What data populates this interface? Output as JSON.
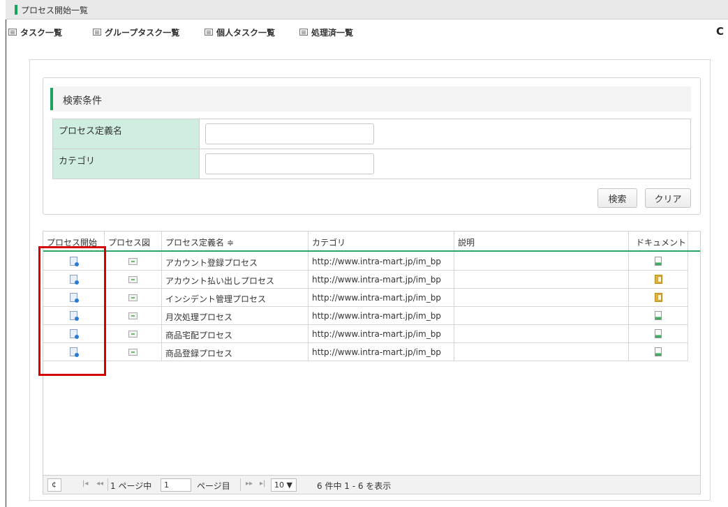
{
  "window": {
    "title": "プロセス開始一覧"
  },
  "tabs": [
    {
      "label": "タスク一覧"
    },
    {
      "label": "グループタスク一覧"
    },
    {
      "label": "個人タスク一覧"
    },
    {
      "label": "処理済一覧"
    }
  ],
  "search": {
    "heading": "検索条件",
    "fields": [
      {
        "label": "プロセス定義名",
        "value": "",
        "placeholder": ""
      },
      {
        "label": "カテゴリ",
        "value": "",
        "placeholder": ""
      }
    ],
    "search_button": "検索",
    "clear_button": "クリア"
  },
  "grid": {
    "columns": [
      "プロセス開始",
      "プロセス図",
      "プロセス定義名 ≑",
      "カテゴリ",
      "説明",
      "ドキュメント"
    ],
    "rows": [
      {
        "name": "アカウント登録プロセス",
        "category": "http://www.intra-mart.jp/im_bp",
        "description": "",
        "doc_icon": "document-icon"
      },
      {
        "name": "アカウント払い出しプロセス",
        "category": "http://www.intra-mart.jp/im_bp",
        "description": "",
        "doc_icon": "folder-document-icon"
      },
      {
        "name": "インシデント管理プロセス",
        "category": "http://www.intra-mart.jp/im_bp",
        "description": "",
        "doc_icon": "folder-document-icon"
      },
      {
        "name": "月次処理プロセス",
        "category": "http://www.intra-mart.jp/im_bp",
        "description": "",
        "doc_icon": "document-icon"
      },
      {
        "name": "商品宅配プロセス",
        "category": "http://www.intra-mart.jp/im_bp",
        "description": "",
        "doc_icon": "document-icon"
      },
      {
        "name": "商品登録プロセス",
        "category": "http://www.intra-mart.jp/im_bp",
        "description": "",
        "doc_icon": "document-icon"
      }
    ]
  },
  "pager": {
    "refresh": "¢",
    "first": "|◂",
    "prev": "◂◂",
    "page_prefix": "1 ページ中",
    "page_value": "1",
    "page_suffix": "ページ目",
    "next": "▸▸",
    "last": "▸|",
    "page_size": "10 ▼",
    "summary": "6 件中 1 - 6 を表示"
  },
  "colors": {
    "accent": "#14a55c",
    "label_bg": "#cfeee0",
    "highlight": "#d50000"
  }
}
